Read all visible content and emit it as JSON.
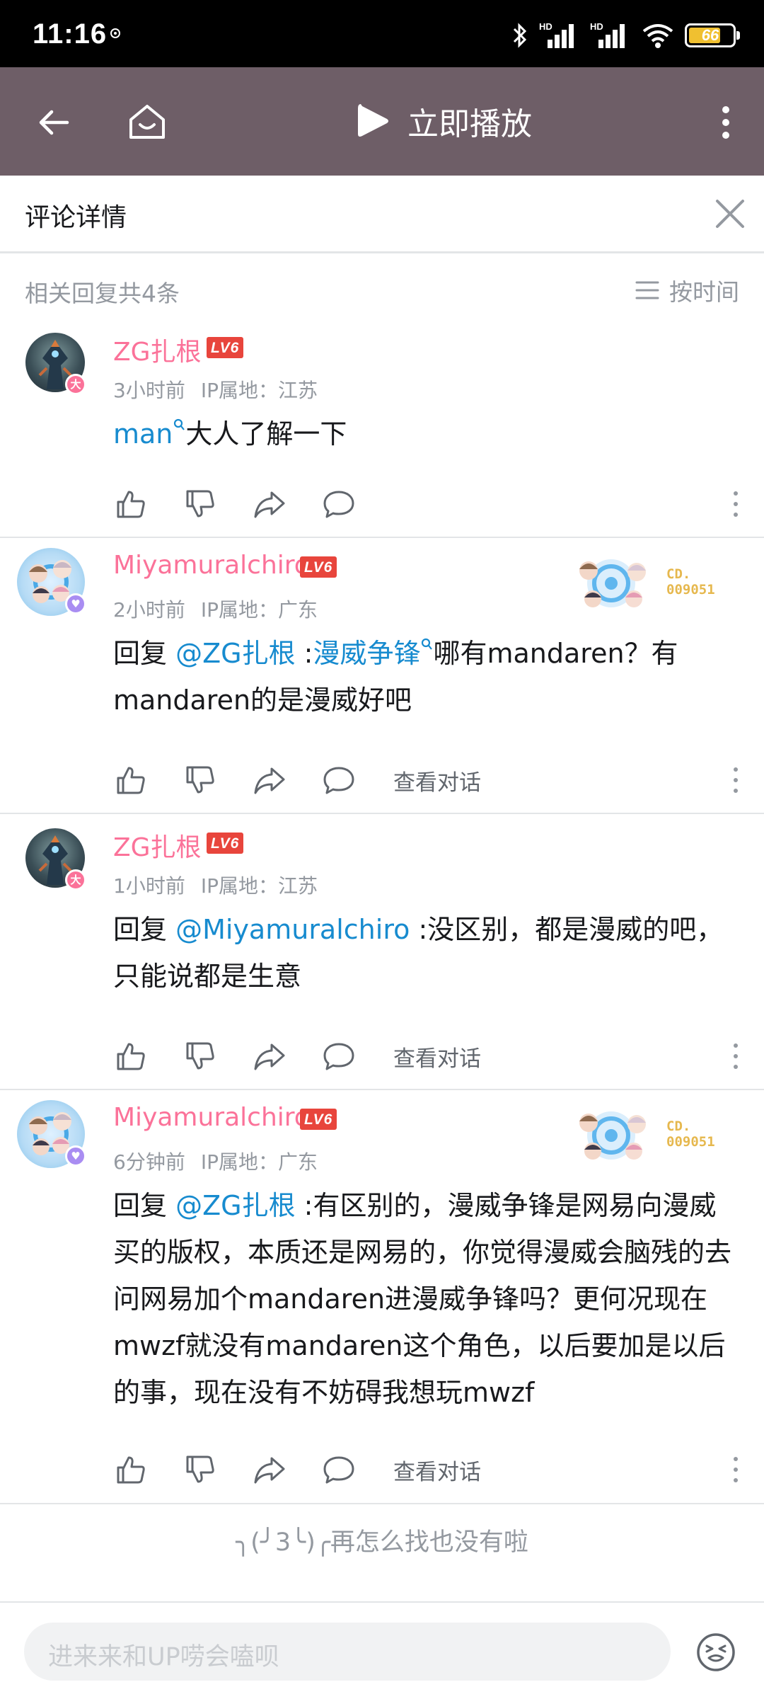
{
  "status_bar": {
    "time": "11:16",
    "battery": "66",
    "network_label": "HD"
  },
  "nav": {
    "play_label": "立即播放"
  },
  "detail": {
    "title": "评论详情",
    "reply_count_text": "相关回复共4条",
    "sort_label": "按时间"
  },
  "comments": [
    {
      "username": "ZG扎根",
      "level": "LV6",
      "time": "3小时前",
      "ip": "IP属地：江苏",
      "reply_prefix": "",
      "mention": "",
      "keyword": "man",
      "text": "大人了解一下",
      "view_conversation": ""
    },
    {
      "username": "Miyamuralchiro",
      "level": "LV6",
      "time": "2小时前",
      "ip": "IP属地：广东",
      "reply_prefix": "回复 ",
      "mention": "@ZG扎根",
      "colon": " :",
      "keyword": "漫威争锋",
      "text": "哪有mandaren？有mandaren的是漫威好吧",
      "view_conversation": "查看对话",
      "badge_no_1": "CD.",
      "badge_no_2": "009051"
    },
    {
      "username": "ZG扎根",
      "level": "LV6",
      "time": "1小时前",
      "ip": "IP属地：江苏",
      "reply_prefix": "回复 ",
      "mention": "@Miyamuralchiro",
      "colon": " :",
      "text": "没区别，都是漫威的吧，只能说都是生意",
      "view_conversation": "查看对话"
    },
    {
      "username": "Miyamuralchiro",
      "level": "LV6",
      "time": "6分钟前",
      "ip": "IP属地：广东",
      "reply_prefix": "回复 ",
      "mention": "@ZG扎根",
      "colon": " :",
      "text": "有区别的，漫威争锋是网易向漫威买的版权，本质还是网易的，你觉得漫威会脑残的去问网易加个mandaren进漫威争锋吗？更何况现在mwzf就没有mandaren这个角色，以后要加是以后的事，现在没有不妨碍我想玩mwzf",
      "view_conversation": "查看对话",
      "badge_no_1": "CD.",
      "badge_no_2": "009051"
    }
  ],
  "end_tip": "╮(╯3╰)╭再怎么找也没有啦",
  "bottom": {
    "input_placeholder": "进来来和UP唠会嗑呗"
  },
  "icons": {
    "back": "back-arrow-icon",
    "home": "home-icon",
    "play": "play-icon",
    "more": "more-vertical-icon",
    "close": "close-icon",
    "sort": "list-sort-icon",
    "like": "thumbs-up-icon",
    "dislike": "thumbs-down-icon",
    "share": "share-icon",
    "comment": "comment-bubble-icon",
    "emoji": "emoji-icon"
  },
  "colors": {
    "nav_bg": "#6e5e67",
    "username": "#fb7299",
    "link": "#178bcf",
    "level_badge": "#e8453c",
    "muted": "#9499a0"
  }
}
